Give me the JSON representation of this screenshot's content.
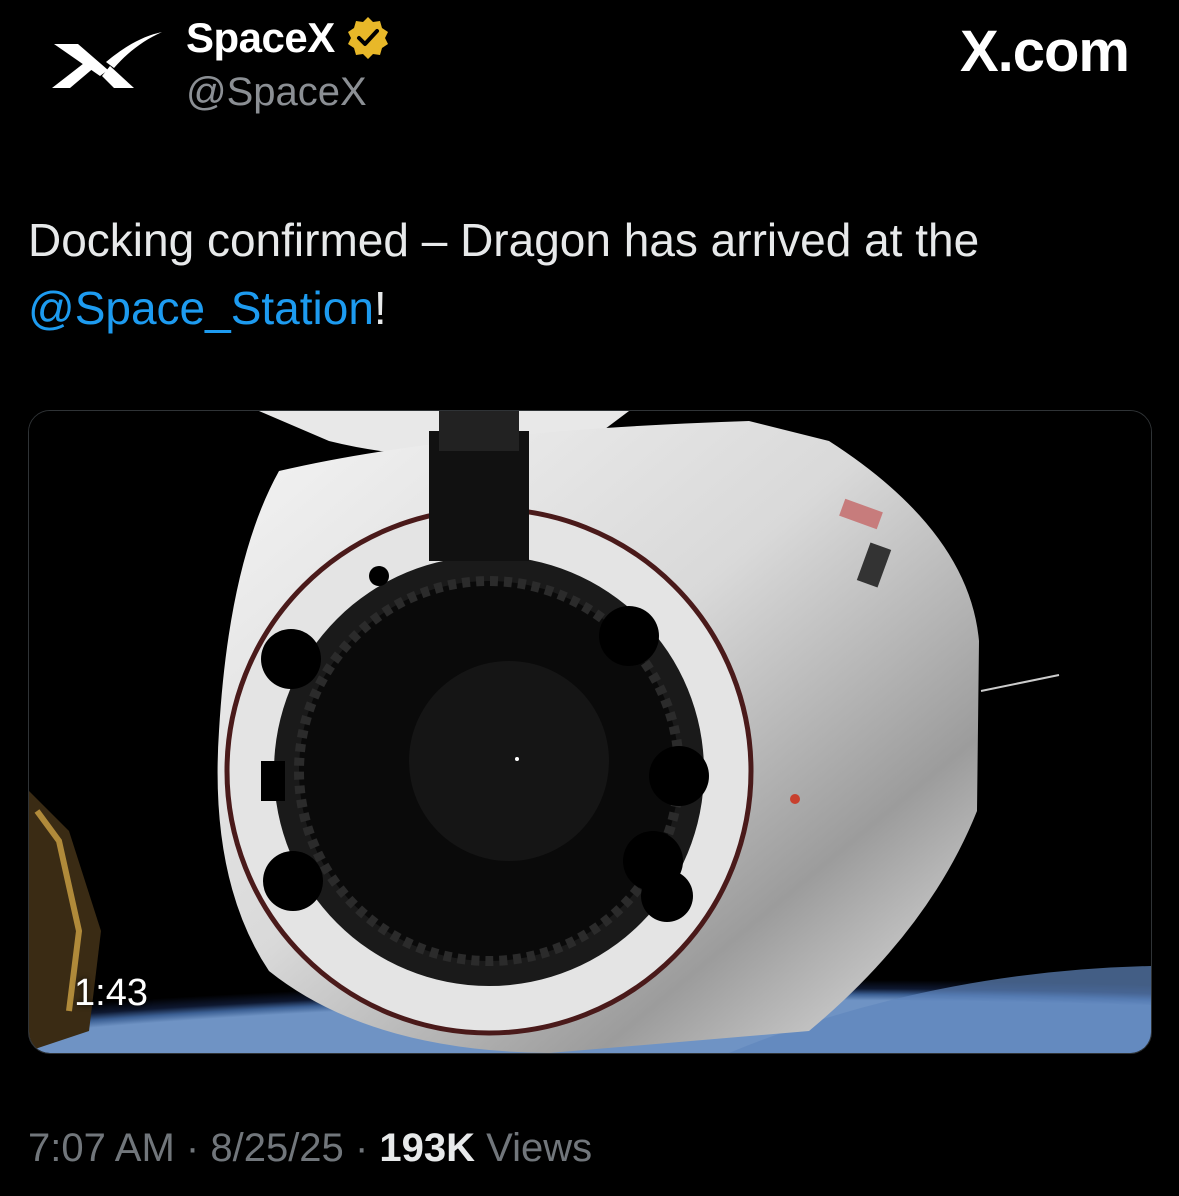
{
  "author": {
    "name": "SpaceX",
    "handle": "@SpaceX",
    "verified_icon": "verified-badge-icon",
    "avatar_icon": "spacex-x-logo-icon"
  },
  "brand": "X.com",
  "tweet": {
    "text_before": "Docking confirmed – Dragon has arrived at the",
    "mention": "@Space_Station",
    "text_after": "!"
  },
  "media": {
    "duration": "1:43",
    "description_icon": "dragon-capsule-video-thumbnail"
  },
  "meta": {
    "time": "7:07 AM",
    "separator": "·",
    "date": "8/25/25",
    "views_count": "193K",
    "views_label": "Views"
  },
  "colors": {
    "background": "#000000",
    "mention": "#1d9bf0",
    "muted": "#71767b",
    "verified": "#e8b829"
  }
}
